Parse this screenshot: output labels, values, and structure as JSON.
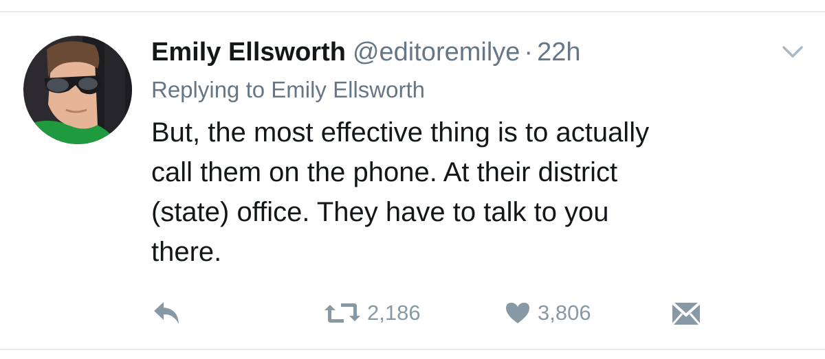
{
  "tweet": {
    "author_name": "Emily Ellsworth",
    "handle": "@editoremilye",
    "separator": "·",
    "time": "22h",
    "replying_to": "Replying to Emily Ellsworth",
    "text_lines": [
      "But, the most effective thing is to actually",
      "call them on the phone. At their district",
      "(state) office. They have to talk to you",
      "there."
    ]
  },
  "actions": {
    "reply_icon": "reply-icon",
    "retweet_icon": "retweet-icon",
    "retweet_count": "2,186",
    "like_icon": "heart-icon",
    "like_count": "3,806",
    "dm_icon": "envelope-icon"
  },
  "colors": {
    "text": "#14171a",
    "secondary": "#657786",
    "action": "#8899a6",
    "divider": "#e6ecf0"
  }
}
